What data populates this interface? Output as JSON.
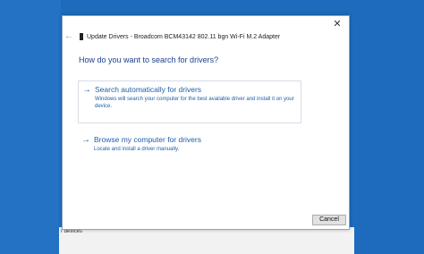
{
  "background": {
    "desktop_color": "#1e6bbd",
    "bottom_label": "r devices"
  },
  "window": {
    "close_icon": "✕",
    "back_icon": "←",
    "title": "Update Drivers - Broadcom BCM43142 802.11 bgn Wi-Fi M.2 Adapter"
  },
  "main": {
    "heading": "How do you want to search for drivers?",
    "options": [
      {
        "arrow": "→",
        "title": "Search automatically for drivers",
        "description": "Windows will search your computer for the best available driver and install it on your device."
      },
      {
        "arrow": "→",
        "title": "Browse my computer for drivers",
        "description": "Locate and install a driver manually."
      }
    ]
  },
  "footer": {
    "cancel_label": "Cancel"
  },
  "colors": {
    "accent": "#1f5fa8",
    "heading": "#1a3e8c"
  }
}
